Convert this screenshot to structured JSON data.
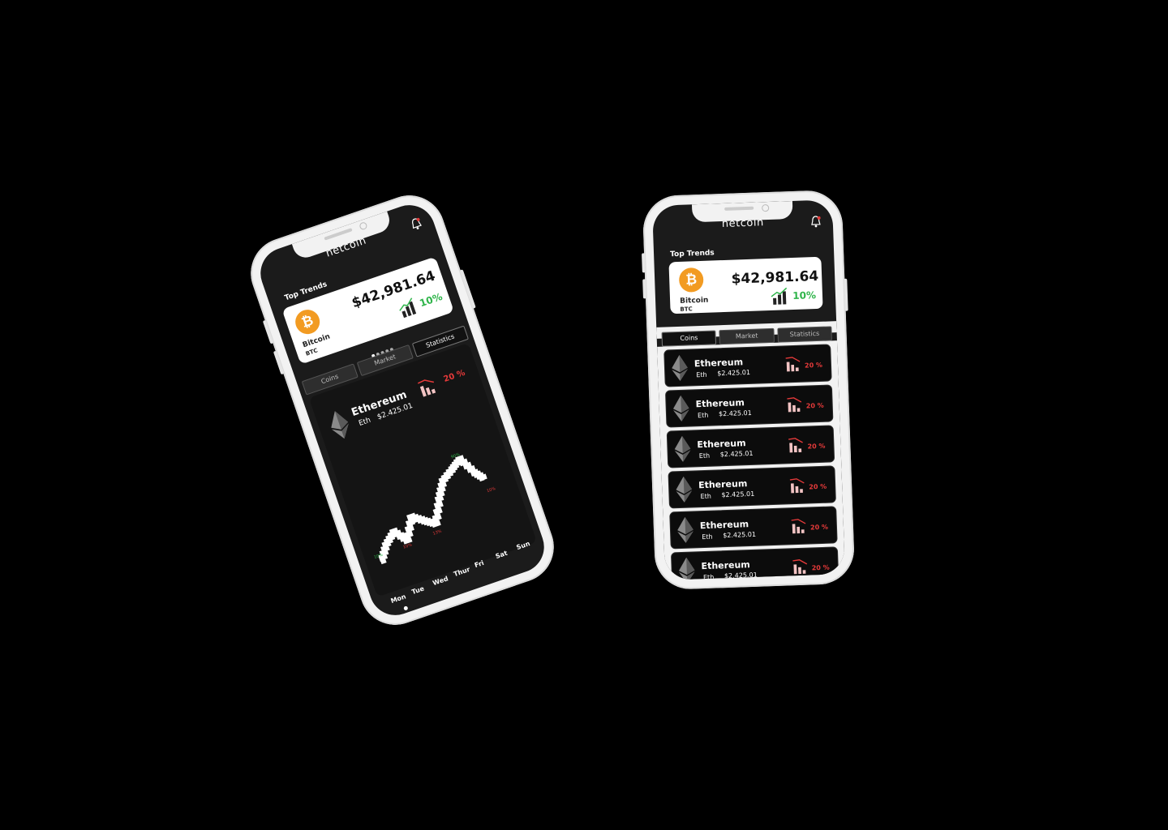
{
  "app": {
    "name": "netcoin",
    "section_title": "Top Trends",
    "pager_dots": 5
  },
  "trend": {
    "coin_name": "Bitcoin",
    "coin_symbol": "BTC",
    "price": "$42,981.64",
    "change": "10%",
    "icon": "bitcoin-icon",
    "glyph": "₿"
  },
  "tabs": [
    "Coins",
    "Market",
    "Statistics"
  ],
  "coin_item": {
    "name": "Ethereum",
    "symbol": "Eth",
    "price": "$2.425.01",
    "change": "20 %",
    "icon": "ethereum-icon"
  },
  "detail": {
    "name": "Ethereum",
    "symbol": "Eth",
    "price": "$2.425.01",
    "change": "20 %"
  },
  "chart_data": {
    "type": "line",
    "categories": [
      "Mon",
      "Tue",
      "Wed",
      "Thur",
      "Fri",
      "Sat",
      "Sun"
    ],
    "annotations": [
      {
        "text": "10%",
        "color": "#2fb44a"
      },
      {
        "text": "10%",
        "color": "#e63a3a"
      },
      {
        "text": "13%",
        "color": "#e63a3a"
      },
      {
        "text": "90%",
        "color": "#2fb44a"
      },
      {
        "text": "10%",
        "color": "#e63a3a"
      }
    ]
  },
  "colors": {
    "positive": "#2fb44a",
    "negative": "#e63a3a",
    "bitcoin": "#f29b22"
  }
}
